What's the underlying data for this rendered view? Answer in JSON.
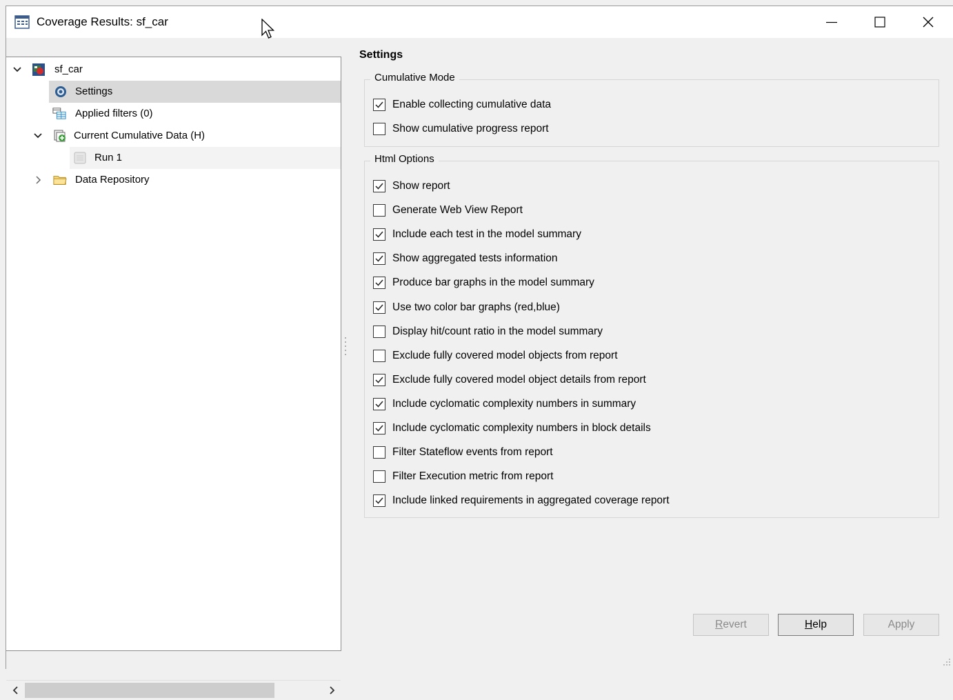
{
  "window": {
    "title": "Coverage Results: sf_car"
  },
  "tree": {
    "root": {
      "label": "sf_car",
      "expanded": true
    },
    "items": [
      {
        "label": "Settings",
        "icon": "gear-icon",
        "selected": true
      },
      {
        "label": "Applied filters (0)",
        "icon": "filter-table-icon"
      },
      {
        "label": "Current Cumulative Data (H)",
        "icon": "cumulative-data-icon",
        "expanded": true
      },
      {
        "label": "Run 1",
        "icon": "run-icon"
      },
      {
        "label": "Data Repository",
        "icon": "folder-icon",
        "expanded": false
      }
    ]
  },
  "settings": {
    "title": "Settings",
    "cumulative_mode": {
      "legend": "Cumulative Mode",
      "options": [
        {
          "label": "Enable collecting cumulative data",
          "checked": true
        },
        {
          "label": "Show cumulative progress report",
          "checked": false
        }
      ]
    },
    "html_options": {
      "legend": "Html Options",
      "options": [
        {
          "label": "Show report",
          "checked": true
        },
        {
          "label": "Generate Web View Report",
          "checked": false
        },
        {
          "label": "Include each test in the model summary",
          "checked": true
        },
        {
          "label": "Show aggregated tests information",
          "checked": true
        },
        {
          "label": "Produce bar graphs in the model summary",
          "checked": true
        },
        {
          "label": "Use two color bar graphs (red,blue)",
          "checked": true
        },
        {
          "label": "Display hit/count ratio in the model summary",
          "checked": false
        },
        {
          "label": "Exclude fully covered model objects from report",
          "checked": false
        },
        {
          "label": "Exclude fully covered model object details from report",
          "checked": true
        },
        {
          "label": "Include cyclomatic complexity numbers in summary",
          "checked": true
        },
        {
          "label": "Include cyclomatic complexity numbers in block details",
          "checked": true
        },
        {
          "label": "Filter Stateflow events from report",
          "checked": false
        },
        {
          "label": "Filter Execution metric from report",
          "checked": false
        },
        {
          "label": "Include linked requirements in aggregated coverage report",
          "checked": true
        }
      ]
    }
  },
  "buttons": {
    "revert": {
      "label": "Revert",
      "mnemonic": "R",
      "rest": "evert",
      "enabled": false
    },
    "help": {
      "label": "Help",
      "mnemonic": "H",
      "rest": "elp",
      "enabled": true
    },
    "apply": {
      "label": "Apply",
      "enabled": false
    }
  }
}
